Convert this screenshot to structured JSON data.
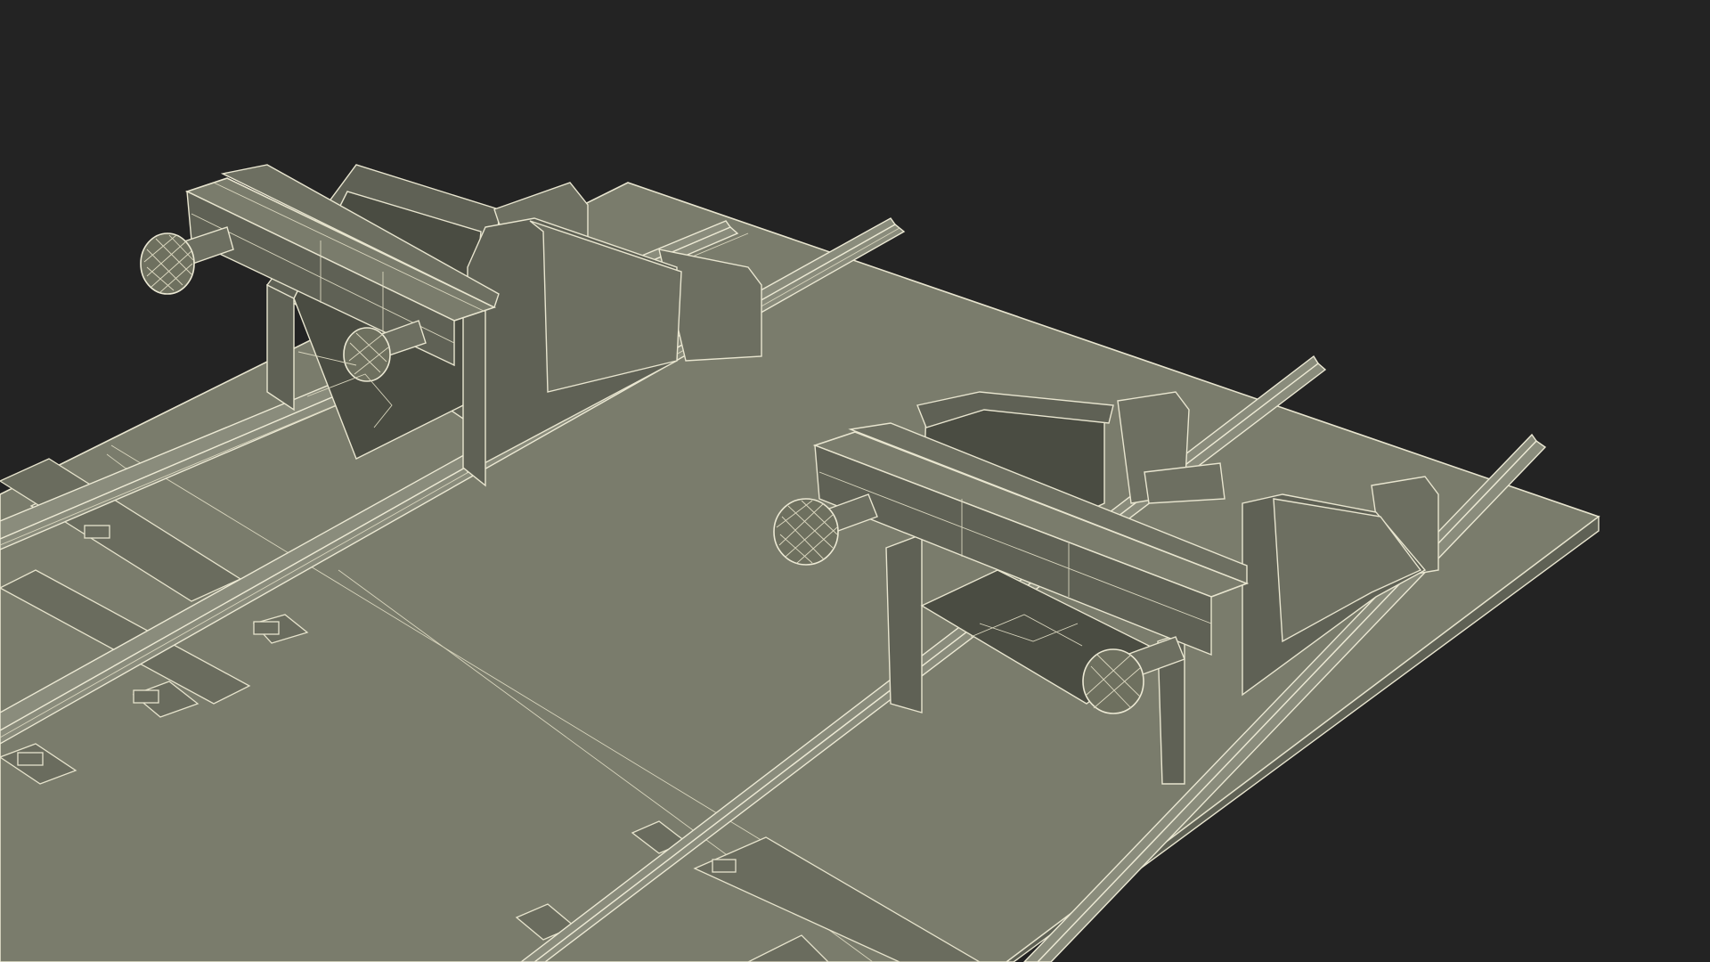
{
  "scene": {
    "background_color": "#232323",
    "model_fill_color": "#6f7163",
    "wire_color": "#e6e3cc",
    "objects": [
      "base-plate",
      "left-rail-track",
      "right-rail-track",
      "left-buffer-stop",
      "right-buffer-stop"
    ]
  }
}
